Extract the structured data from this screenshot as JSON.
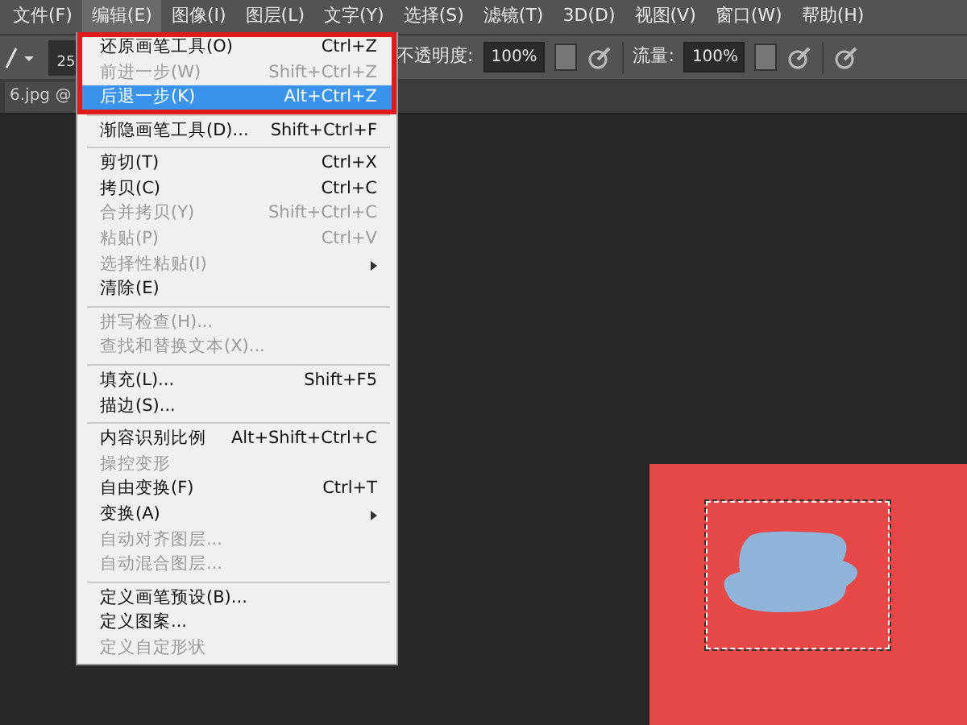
{
  "menubar": [
    {
      "label": "文件(F)",
      "selected": false
    },
    {
      "label": "编辑(E)",
      "selected": true
    },
    {
      "label": "图像(I)",
      "selected": false
    },
    {
      "label": "图层(L)",
      "selected": false
    },
    {
      "label": "文字(Y)",
      "selected": false
    },
    {
      "label": "选择(S)",
      "selected": false
    },
    {
      "label": "滤镜(T)",
      "selected": false
    },
    {
      "label": "3D(D)",
      "selected": false
    },
    {
      "label": "视图(V)",
      "selected": false
    },
    {
      "label": "窗口(W)",
      "selected": false
    },
    {
      "label": "帮助(H)",
      "selected": false
    }
  ],
  "toolbar": {
    "brush_size": "25",
    "opacity_label": "不透明度:",
    "opacity_value": "100%",
    "flow_label": "流量:",
    "flow_value": "100%"
  },
  "document_tab": {
    "title": "6.jpg @"
  },
  "edit_menu": {
    "sections": [
      {
        "highlighted": true,
        "items": [
          {
            "label": "还原画笔工具(O)",
            "shortcut": "Ctrl+Z",
            "disabled": false,
            "selected": false,
            "submenu": false
          },
          {
            "label": "前进一步(W)",
            "shortcut": "Shift+Ctrl+Z",
            "disabled": true,
            "selected": false,
            "submenu": false
          },
          {
            "label": "后退一步(K)",
            "shortcut": "Alt+Ctrl+Z",
            "disabled": false,
            "selected": true,
            "submenu": false
          }
        ]
      },
      {
        "items": [
          {
            "label": "渐隐画笔工具(D)...",
            "shortcut": "Shift+Ctrl+F",
            "disabled": false,
            "selected": false,
            "submenu": false
          }
        ]
      },
      {
        "items": [
          {
            "label": "剪切(T)",
            "shortcut": "Ctrl+X",
            "disabled": false,
            "selected": false,
            "submenu": false
          },
          {
            "label": "拷贝(C)",
            "shortcut": "Ctrl+C",
            "disabled": false,
            "selected": false,
            "submenu": false
          },
          {
            "label": "合并拷贝(Y)",
            "shortcut": "Shift+Ctrl+C",
            "disabled": true,
            "selected": false,
            "submenu": false
          },
          {
            "label": "粘贴(P)",
            "shortcut": "Ctrl+V",
            "disabled": true,
            "selected": false,
            "submenu": false
          },
          {
            "label": "选择性粘贴(I)",
            "disabled": true,
            "selected": false,
            "submenu": true
          },
          {
            "label": "清除(E)",
            "disabled": false,
            "selected": false,
            "submenu": false
          }
        ]
      },
      {
        "items": [
          {
            "label": "拼写检查(H)...",
            "disabled": true,
            "selected": false,
            "submenu": false
          },
          {
            "label": "查找和替换文本(X)...",
            "disabled": true,
            "selected": false,
            "submenu": false
          }
        ]
      },
      {
        "items": [
          {
            "label": "填充(L)...",
            "shortcut": "Shift+F5",
            "disabled": false,
            "selected": false,
            "submenu": false
          },
          {
            "label": "描边(S)...",
            "disabled": false,
            "selected": false,
            "submenu": false
          }
        ]
      },
      {
        "items": [
          {
            "label": "内容识别比例",
            "shortcut": "Alt+Shift+Ctrl+C",
            "disabled": false,
            "selected": false,
            "submenu": false
          },
          {
            "label": "操控变形",
            "disabled": true,
            "selected": false,
            "submenu": false
          },
          {
            "label": "自由变换(F)",
            "shortcut": "Ctrl+T",
            "disabled": false,
            "selected": false,
            "submenu": false
          },
          {
            "label": "变换(A)",
            "disabled": false,
            "selected": false,
            "submenu": true
          },
          {
            "label": "自动对齐图层...",
            "disabled": true,
            "selected": false,
            "submenu": false
          },
          {
            "label": "自动混合图层...",
            "disabled": true,
            "selected": false,
            "submenu": false
          }
        ]
      },
      {
        "items": [
          {
            "label": "定义画笔预设(B)...",
            "disabled": false,
            "selected": false,
            "submenu": false
          },
          {
            "label": "定义图案...",
            "disabled": false,
            "selected": false,
            "submenu": false
          },
          {
            "label": "定义自定形状",
            "disabled": true,
            "selected": false,
            "submenu": false
          }
        ]
      }
    ]
  }
}
